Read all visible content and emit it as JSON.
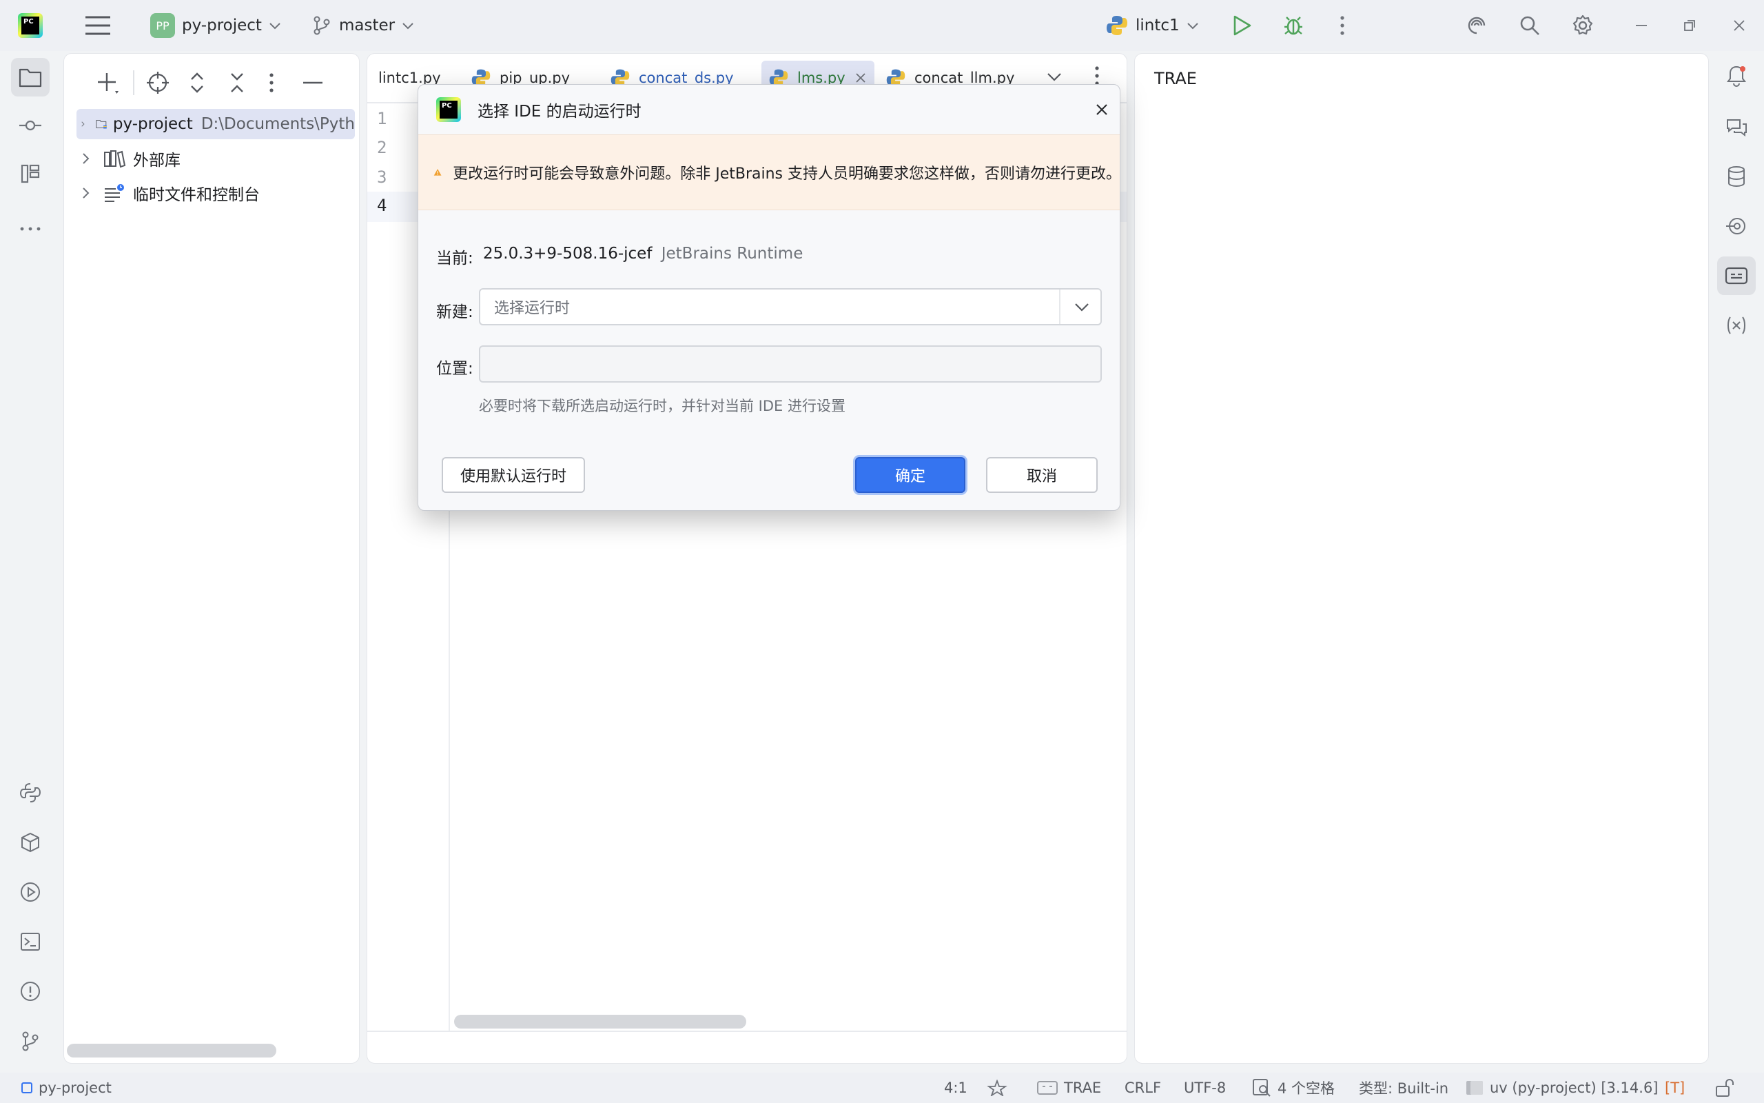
{
  "titlebar": {
    "app_logo_text": "PC",
    "project_badge": "PP",
    "project_name": "py-project",
    "branch": "master",
    "run_config": "lintc1"
  },
  "project_tree": {
    "items": [
      {
        "label": "py-project",
        "path": "D:\\Documents\\Pyth"
      },
      {
        "label": "外部库",
        "path": ""
      },
      {
        "label": "临时文件和控制台",
        "path": ""
      }
    ]
  },
  "editor": {
    "tabs": [
      {
        "label": "lintc1.py",
        "active": false
      },
      {
        "label": "pip_up.py",
        "active": false
      },
      {
        "label": "concat_ds.py",
        "active": false
      },
      {
        "label": "lms.py",
        "active": true
      },
      {
        "label": "concat_llm.py",
        "active": false
      }
    ],
    "line_numbers": [
      "1",
      "2",
      "3",
      "4"
    ]
  },
  "preview": {
    "text": "TRAE"
  },
  "dialog": {
    "title": "选择 IDE 的启动运行时",
    "warning": "更改运行时可能会导致意外问题。除非 JetBrains 支持人员明确要求您这样做，否则请勿进行更改。",
    "current_label": "当前:",
    "current_version": "25.0.3+9-508.16-jcef",
    "current_vendor": "JetBrains Runtime",
    "new_label": "新建:",
    "new_placeholder": "选择运行时",
    "location_label": "位置:",
    "location_value": "",
    "hint": "必要时将下载所选启动运行时，并针对当前 IDE 进行设置",
    "use_default_button": "使用默认运行时",
    "ok_button": "确定",
    "cancel_button": "取消"
  },
  "statusbar": {
    "project": "py-project",
    "position": "4:1",
    "trae": "TRAE",
    "line_sep": "CRLF",
    "encoding": "UTF-8",
    "indent": "4 个空格",
    "file_type": "类型: Built-in",
    "interpreter": "uv (py-project) [3.14.6]",
    "t_badge": "[T]"
  },
  "colors": {
    "accent": "#3574f0",
    "warning_bg": "#fdf1e6",
    "warning_icon": "#f0a030",
    "run_green": "#4fa35a"
  }
}
